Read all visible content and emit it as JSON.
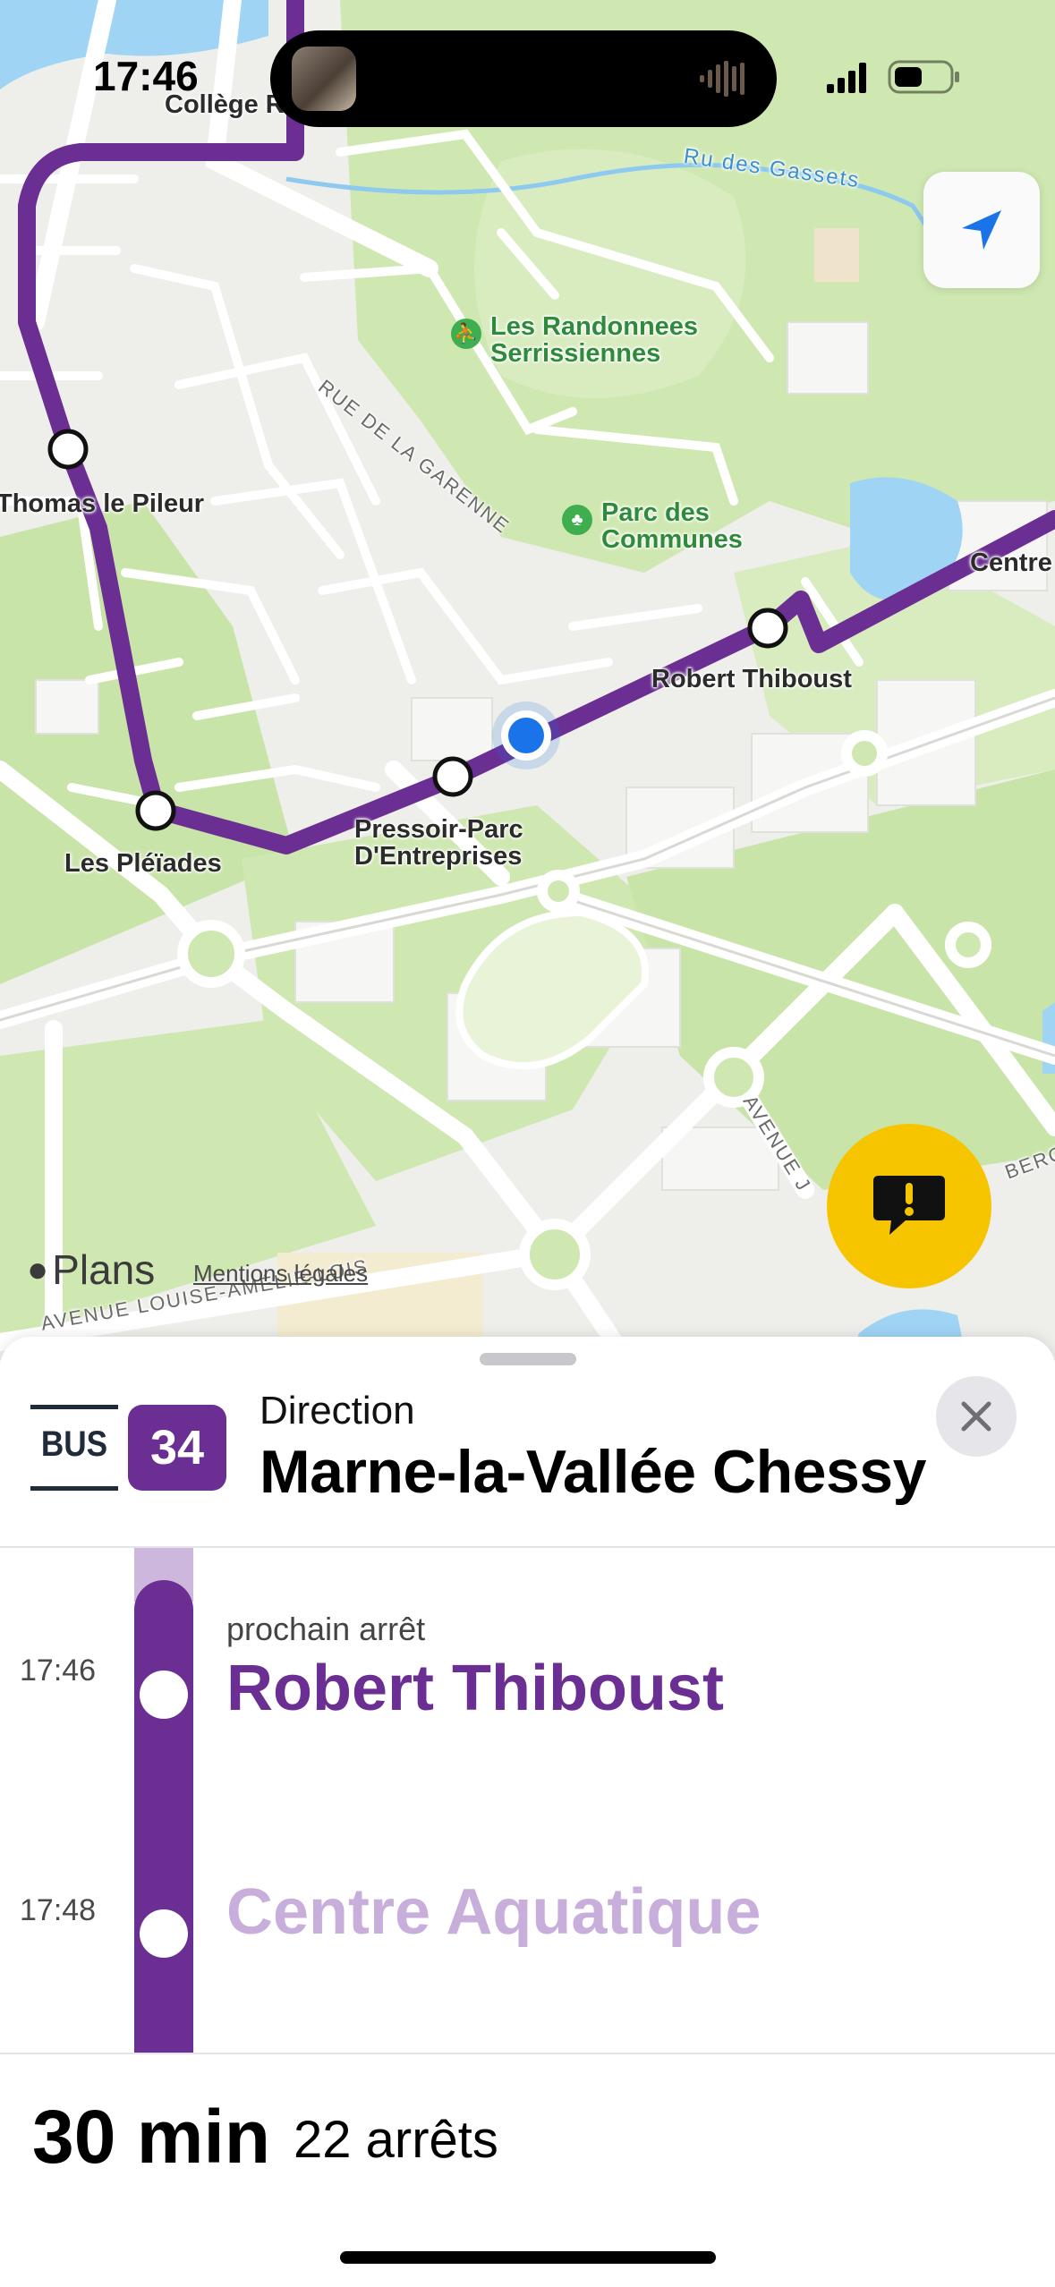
{
  "status_bar": {
    "time": "17:46"
  },
  "map": {
    "attribution": "Plans",
    "legal_link": "Mentions légales",
    "stops": [
      {
        "name": "Collège Renaud / Les Marmousets"
      },
      {
        "name": "Thomas le Pileur"
      },
      {
        "name": "Les Pléïades"
      },
      {
        "name": "Pressoir-Parc D'Entreprises"
      },
      {
        "name": "Robert Thiboust"
      },
      {
        "name": "Centre"
      }
    ],
    "pois": [
      {
        "name": "Les Randonnees Serrissiennes",
        "icon": "hiking-icon"
      },
      {
        "name": "Parc des Communes",
        "icon": "tree-icon"
      }
    ],
    "streets": [
      "RUE DE LA GARENNE",
      "AVENUE LOUISE-AMÉLIE-LOIS",
      "AVENUE J",
      "BERG"
    ],
    "water": [
      "Ru des Gassets"
    ],
    "colors": {
      "route": "#6B2E92",
      "park": "#CBE7AE",
      "water": "#9FD4F5",
      "road": "#FFFFFF",
      "user": "#1A73E8"
    }
  },
  "sheet": {
    "mode_label": "BUS",
    "line_number": "34",
    "line_color": "#6B2E92",
    "direction_label": "Direction",
    "direction_name": "Marne-la-Vallée Chessy",
    "next_stop_label": "prochain arrêt",
    "upcoming_stops": [
      {
        "time": "17:46",
        "name": "Robert Thiboust",
        "state": "next"
      },
      {
        "time": "17:48",
        "name": "Centre Aquatique",
        "state": "future"
      }
    ],
    "duration": "30 min",
    "stops_count": "22 arrêts"
  }
}
